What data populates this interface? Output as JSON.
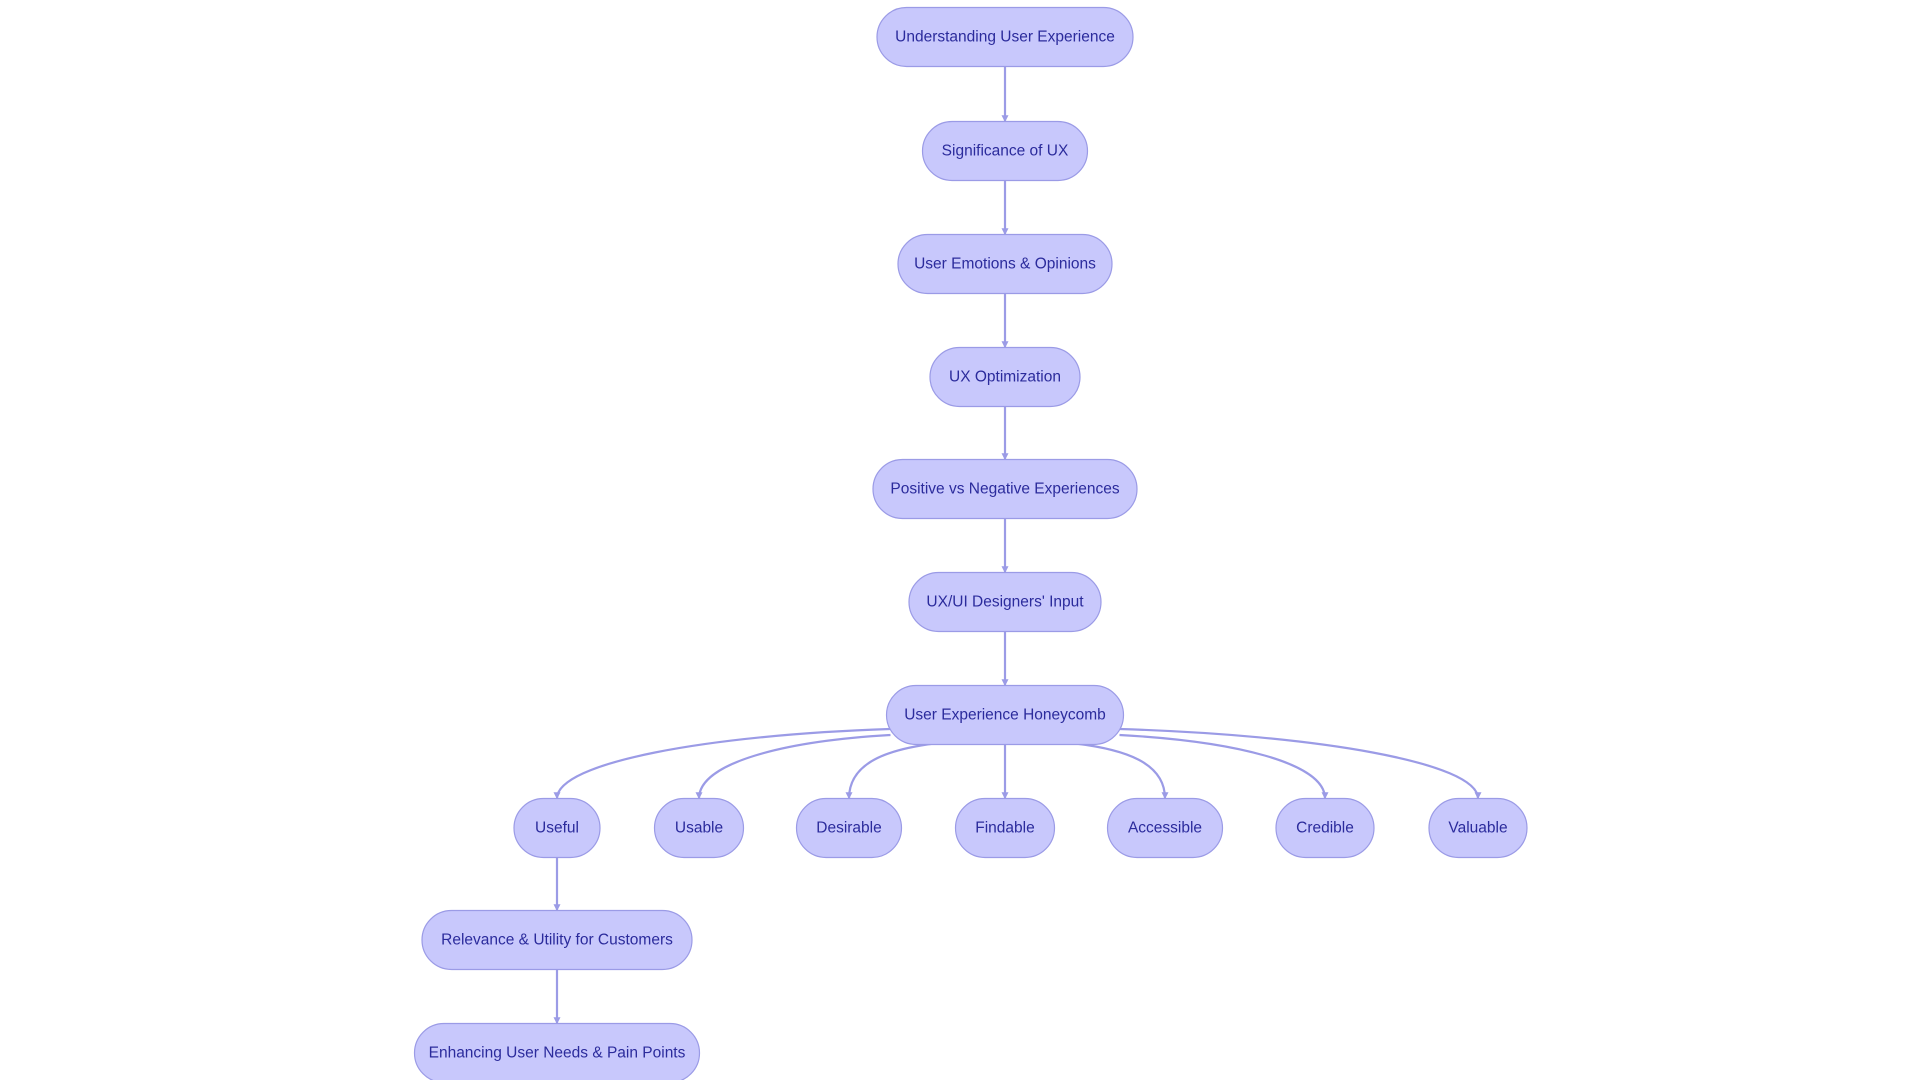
{
  "diagram": {
    "type": "flowchart",
    "colors": {
      "node_fill": "#c8c8fc",
      "node_stroke": "#9b9be6",
      "text": "#2b2b9c",
      "edge": "#9b9be6"
    },
    "nodes": [
      {
        "id": "understanding",
        "label": "Understanding User Experience"
      },
      {
        "id": "significance",
        "label": "Significance of UX"
      },
      {
        "id": "emotions",
        "label": "User Emotions & Opinions"
      },
      {
        "id": "optimization",
        "label": "UX Optimization"
      },
      {
        "id": "posneg",
        "label": "Positive vs Negative Experiences"
      },
      {
        "id": "designers",
        "label": "UX/UI Designers' Input"
      },
      {
        "id": "honeycomb",
        "label": "User Experience Honeycomb"
      },
      {
        "id": "useful",
        "label": "Useful"
      },
      {
        "id": "usable",
        "label": "Usable"
      },
      {
        "id": "desirable",
        "label": "Desirable"
      },
      {
        "id": "findable",
        "label": "Findable"
      },
      {
        "id": "accessible",
        "label": "Accessible"
      },
      {
        "id": "credible",
        "label": "Credible"
      },
      {
        "id": "valuable",
        "label": "Valuable"
      },
      {
        "id": "relevance",
        "label": "Relevance & Utility for Customers"
      },
      {
        "id": "enhancing",
        "label": "Enhancing User Needs & Pain Points"
      }
    ],
    "edges": [
      {
        "from": "understanding",
        "to": "significance"
      },
      {
        "from": "significance",
        "to": "emotions"
      },
      {
        "from": "emotions",
        "to": "optimization"
      },
      {
        "from": "optimization",
        "to": "posneg"
      },
      {
        "from": "posneg",
        "to": "designers"
      },
      {
        "from": "designers",
        "to": "honeycomb"
      },
      {
        "from": "honeycomb",
        "to": "useful"
      },
      {
        "from": "honeycomb",
        "to": "usable"
      },
      {
        "from": "honeycomb",
        "to": "desirable"
      },
      {
        "from": "honeycomb",
        "to": "findable"
      },
      {
        "from": "honeycomb",
        "to": "accessible"
      },
      {
        "from": "honeycomb",
        "to": "credible"
      },
      {
        "from": "honeycomb",
        "to": "valuable"
      },
      {
        "from": "useful",
        "to": "relevance"
      },
      {
        "from": "relevance",
        "to": "enhancing"
      }
    ]
  }
}
